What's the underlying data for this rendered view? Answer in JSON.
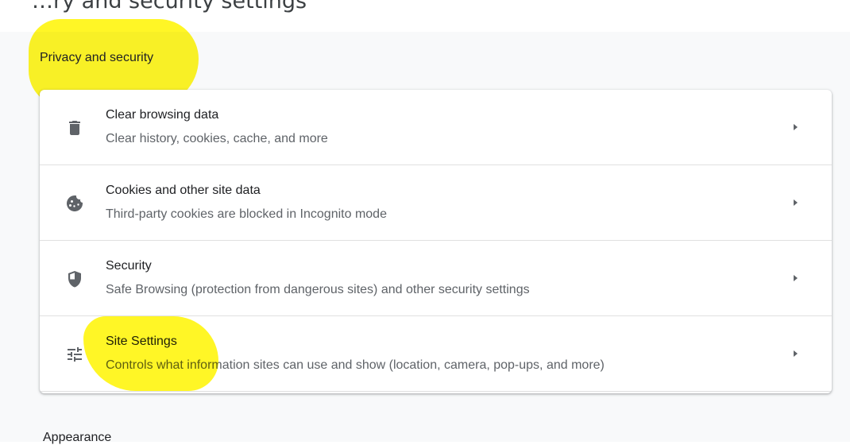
{
  "top_cutoff_text": "…ry and security settings",
  "section": {
    "title": "Privacy and security"
  },
  "rows": [
    {
      "title": "Clear browsing data",
      "subtitle": "Clear history, cookies, cache, and more",
      "icon": "trash-icon"
    },
    {
      "title": "Cookies and other site data",
      "subtitle": "Third-party cookies are blocked in Incognito mode",
      "icon": "cookie-icon"
    },
    {
      "title": "Security",
      "subtitle": "Safe Browsing (protection from dangerous sites) and other security settings",
      "icon": "shield-icon"
    },
    {
      "title": "Site Settings",
      "subtitle": "Controls what information sites can use and show (location, camera, pop-ups, and more)",
      "icon": "tune-icon"
    }
  ],
  "next_section": {
    "title": "Appearance"
  },
  "colors": {
    "background": "#f8f9fa",
    "card": "#ffffff",
    "highlight": "#fff200",
    "secondary_text": "#5f6368"
  }
}
